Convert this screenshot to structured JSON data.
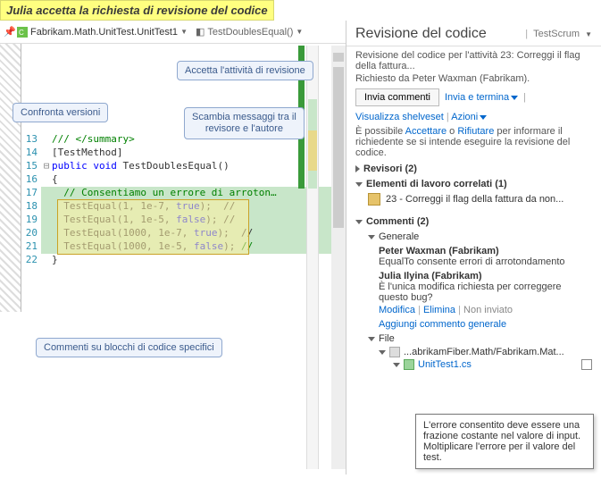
{
  "banner": "Julia accetta la richiesta di revisione del codice",
  "tabs": {
    "file_tab": "Fabrikam.Math.UnitTest.UnitTest1",
    "func_sel": "TestDoublesEqual()"
  },
  "callouts": {
    "accept": "Accetta l'attività di revisione",
    "compare": "Confronta versioni",
    "exchange1": "Scambia messaggi tra il",
    "exchange2": "revisore e l'autore",
    "blocks": "Commenti su blocchi di codice specifici"
  },
  "code": {
    "l13": "/// </summary>",
    "l14": "[TestMethod]",
    "l15a": "public",
    "l15b": " void",
    "l15c": " TestDoublesEqual()",
    "l16": "{",
    "l17": "  // Consentiamo un errore di arroton…",
    "l18a": "  TestEqual(1, 1e-7, ",
    "l18b": "true",
    "l18c": ");  //",
    "l19a": "  TestEqual(1, 1e-5, ",
    "l19b": "false",
    "l19c": "); //",
    "l20a": "  TestEqual(1000, 1e-7, ",
    "l20b": "true",
    "l20c": ");  //",
    "l21a": "  TestEqual(1000, 1e-5, ",
    "l21b": "false",
    "l21c": ");",
    "l21d": " //",
    "l22": "}"
  },
  "panel": {
    "title": "Revisione del codice",
    "team": "TestScrum",
    "desc1": "Revisione del codice per l'attività 23: Correggi il flag della fattura...",
    "desc2": "Richiesto da Peter Waxman (Fabrikam).",
    "btn_send": "Invia commenti",
    "btn_send_close": "Invia e termina",
    "link_shelve": "Visualizza shelveset",
    "link_actions": "Azioni",
    "info_a": "È possibile ",
    "info_accept": "Accettare",
    "info_b": " o ",
    "info_reject": "Rifiutare",
    "info_c": " per informare il richiedente se si intende eseguire la revisione del codice.",
    "sec_reviewers": "Revisori (2)",
    "sec_related": "Elementi di lavoro correlati (1)",
    "wi_text": "23 - Correggi il flag della fattura da non...",
    "sec_comments": "Commenti (2)",
    "sec_general": "Generale",
    "c1_auth": "Peter Waxman (Fabrikam)",
    "c1_txt": "EqualTo consente errori di arrotondamento",
    "c2_auth": "Julia Ilyina (Fabrikam)",
    "c2_txt": "È l'unica modifica richiesta per correggere questo bug?",
    "link_edit": "Modifica",
    "link_del": "Elimina",
    "txt_unsent": "Non inviato",
    "link_addgen": "Aggiungi commento generale",
    "sec_file": "File",
    "file_proj": "...abrikamFiber.Math/Fabrikam.Mat...",
    "file_cs": "UnitTest1.cs",
    "tooltip": "L'errore consentito deve essere una frazione costante nel valore di input. Moltiplicare l'errore per il valore del test."
  }
}
